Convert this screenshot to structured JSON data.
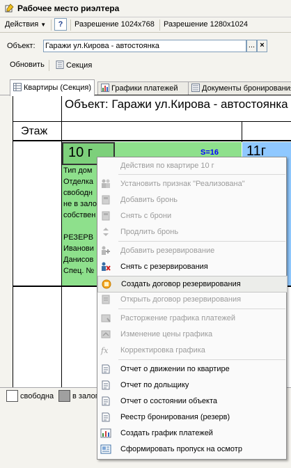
{
  "window": {
    "title": "Рабочее место риэлтера"
  },
  "toolbar": {
    "actions_label": "Действия",
    "help_label": "?",
    "res1_label": "Разрешение 1024x768",
    "res2_label": "Разрешение 1280x1024"
  },
  "object_field": {
    "label": "Объект:",
    "value": "Гаражи ул.Кирова - автостоянка",
    "dots": "...",
    "clear": "×"
  },
  "actions_bar": {
    "refresh_label": "Обновить",
    "section_label": "Секция"
  },
  "tabs": [
    {
      "label": "Квартиры (Секция)"
    },
    {
      "label": "Графики платежей"
    },
    {
      "label": "Документы бронирования"
    }
  ],
  "grid": {
    "title": "Объект: Гаражи ул.Кирова - автостоянка",
    "floor_label": "Этаж",
    "apartment": {
      "name": "10 г",
      "area": "S=16",
      "lines": [
        "Тип дом",
        "Отделка",
        "свободн",
        "не в зало",
        "собствен",
        "",
        "РЕЗЕРВ",
        "Иванови",
        "Данисов",
        "Спец. №"
      ]
    },
    "apartment2": {
      "name": "11г"
    }
  },
  "legend": [
    {
      "label": "свободна",
      "color": "#ffffff"
    },
    {
      "label": "в залог",
      "color": "#a0a0a0"
    }
  ],
  "context_menu": {
    "items": [
      {
        "label": "Действия по квартире 10 г",
        "icon": "none",
        "disabled": true
      },
      {
        "label": "Установить признак \"Реализована\"",
        "icon": "people-icon",
        "disabled": true
      },
      {
        "label": "Добавить бронь",
        "icon": "document-add-icon",
        "disabled": true
      },
      {
        "label": "Снять с брони",
        "icon": "document-remove-icon",
        "disabled": true
      },
      {
        "label": "Продлить бронь",
        "icon": "extend-icon",
        "disabled": true
      },
      {
        "label": "Добавить резервирование",
        "icon": "person-add-icon",
        "disabled": true
      },
      {
        "label": "Снять с резервирования",
        "icon": "person-remove-icon",
        "disabled": false
      },
      {
        "label": "Создать договор резервирования",
        "icon": "contract-icon",
        "disabled": false,
        "active": true
      },
      {
        "label": "Открыть договор резервирования",
        "icon": "open-contract-icon",
        "disabled": true
      },
      {
        "label": "Расторжение графика платежей",
        "icon": "schedule-cancel-icon",
        "disabled": true
      },
      {
        "label": "Изменение цены графика",
        "icon": "price-change-icon",
        "disabled": true
      },
      {
        "label": "Корректировка графика",
        "icon": "function-icon",
        "disabled": true
      },
      {
        "label": "Отчет о движении по квартире",
        "icon": "report-icon",
        "disabled": false
      },
      {
        "label": "Отчет по дольщику",
        "icon": "report-icon",
        "disabled": false
      },
      {
        "label": "Отчет о состоянии объекта",
        "icon": "report-icon",
        "disabled": false
      },
      {
        "label": "Реестр бронирования (резерв)",
        "icon": "report-icon",
        "disabled": false
      },
      {
        "label": "Создать график платежей",
        "icon": "chart-icon",
        "disabled": false
      },
      {
        "label": "Сформировать пропуск на осмотр",
        "icon": "pass-icon",
        "disabled": false
      }
    ]
  },
  "colors": {
    "apartment_green": "#8ee08c",
    "apartment_blue": "#8fc8ff",
    "area_text": "#0000ff"
  }
}
